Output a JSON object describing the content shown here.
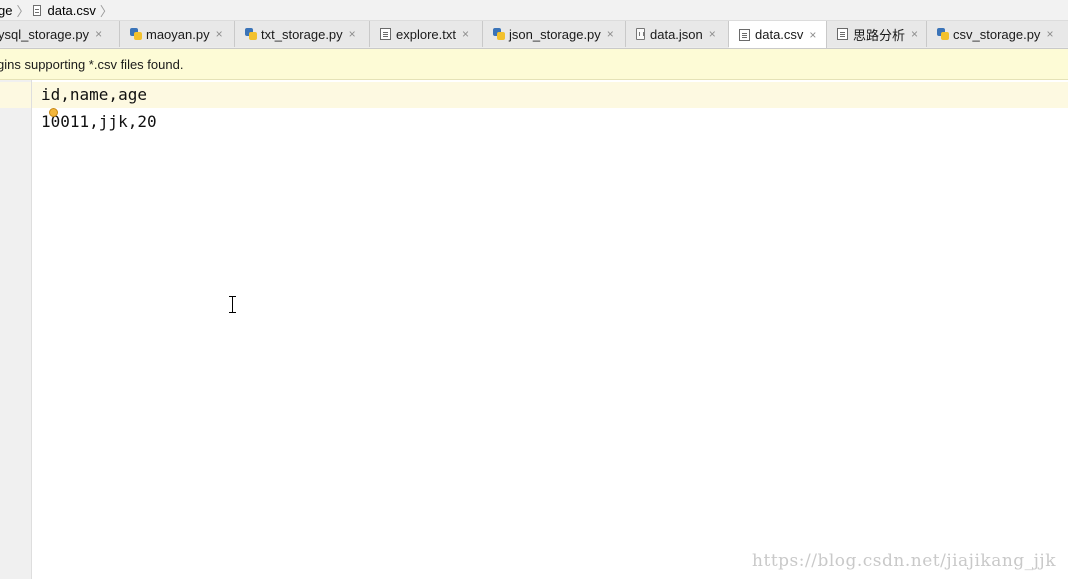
{
  "breadcrumb": {
    "items": [
      {
        "label": "ge"
      },
      {
        "label": "data.csv"
      }
    ]
  },
  "tabs": [
    {
      "label": "ysql_storage.py",
      "icon": "python-file-icon",
      "active": false
    },
    {
      "label": "maoyan.py",
      "icon": "python-file-icon",
      "active": false
    },
    {
      "label": "txt_storage.py",
      "icon": "python-file-icon",
      "active": false
    },
    {
      "label": "explore.txt",
      "icon": "text-file-icon",
      "active": false
    },
    {
      "label": "json_storage.py",
      "icon": "python-file-icon",
      "active": false
    },
    {
      "label": "data.json",
      "icon": "json-file-icon",
      "active": false
    },
    {
      "label": "data.csv",
      "icon": "text-file-icon",
      "active": true
    },
    {
      "label": "思路分析",
      "icon": "text-file-icon",
      "active": false
    },
    {
      "label": "csv_storage.py",
      "icon": "python-file-icon",
      "active": false
    }
  ],
  "close_glyph": "×",
  "notification": {
    "text": "gins supporting *.csv files found."
  },
  "editor": {
    "lines": [
      "id,name,age",
      "10011,jjk,20"
    ]
  },
  "watermark": "https://blog.csdn.net/jiajikang_jjk"
}
